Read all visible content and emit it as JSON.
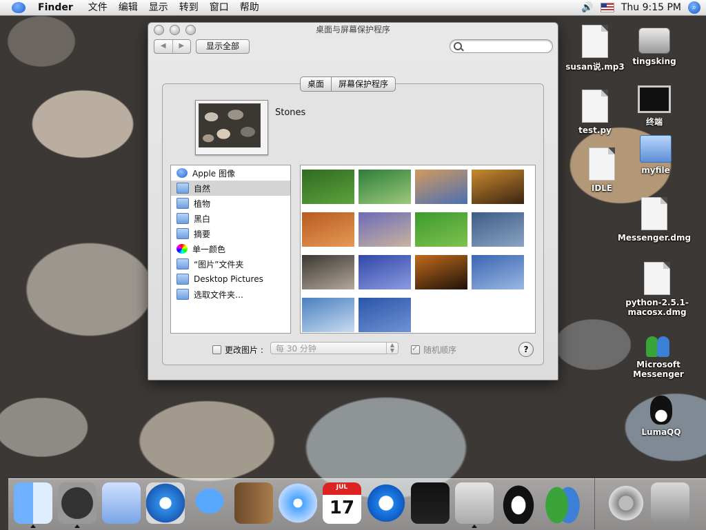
{
  "menubar": {
    "app_name": "Finder",
    "menus": [
      "文件",
      "编辑",
      "显示",
      "转到",
      "窗口",
      "帮助"
    ],
    "clock": "Thu 9:15 PM"
  },
  "window": {
    "title": "桌面与屏幕保护程序",
    "show_all": "显示全部",
    "search_placeholder": "",
    "tabs": [
      "桌面",
      "屏幕保护程序"
    ],
    "current_picture_name": "Stones",
    "sources": [
      {
        "label": "Apple 图像",
        "icon": "apple-icon",
        "selected": false
      },
      {
        "label": "自然",
        "icon": "folder-icon",
        "selected": true
      },
      {
        "label": "植物",
        "icon": "folder-icon",
        "selected": false
      },
      {
        "label": "黑白",
        "icon": "folder-icon",
        "selected": false
      },
      {
        "label": "摘要",
        "icon": "folder-icon",
        "selected": false
      },
      {
        "label": "单一颜色",
        "icon": "color-wheel-icon",
        "selected": false
      },
      {
        "label": "“图片”文件夹",
        "icon": "folder-icon",
        "selected": false
      },
      {
        "label": "Desktop Pictures",
        "icon": "folder-icon",
        "selected": false
      },
      {
        "label": "选取文件夹…",
        "icon": "folder-icon",
        "selected": false
      }
    ],
    "thumbnails": [
      {
        "name": "ladybugs-leaves",
        "colors": [
          "#2f6b22",
          "#5da23c"
        ]
      },
      {
        "name": "green-dewdrop",
        "colors": [
          "#2e7d3a",
          "#9cc97a"
        ]
      },
      {
        "name": "sunset-water",
        "colors": [
          "#d39a5e",
          "#4a6fb3"
        ]
      },
      {
        "name": "leopard-fur",
        "colors": [
          "#c98a2e",
          "#3a2412"
        ]
      },
      {
        "name": "sand-dunes",
        "colors": [
          "#b85a22",
          "#e59a55"
        ]
      },
      {
        "name": "purple-ripples",
        "colors": [
          "#6c6bb8",
          "#c9b3a0"
        ]
      },
      {
        "name": "ladybug-green",
        "colors": [
          "#3c9a2e",
          "#7fc24f"
        ]
      },
      {
        "name": "blue-waves",
        "colors": [
          "#3e5c86",
          "#8aa3c2"
        ]
      },
      {
        "name": "stones",
        "colors": [
          "#3b3733",
          "#b3a89a"
        ]
      },
      {
        "name": "blue-flow",
        "colors": [
          "#3047a8",
          "#8c9ae0"
        ]
      },
      {
        "name": "tiger-stripes",
        "colors": [
          "#c26a1c",
          "#1e120a"
        ]
      },
      {
        "name": "blue-reflection",
        "colors": [
          "#3a65b0",
          "#9ab7e4"
        ]
      },
      {
        "name": "ocean-blue",
        "colors": [
          "#4b7fbf",
          "#c7dcf2"
        ]
      },
      {
        "name": "rippled-sand-blue",
        "colors": [
          "#2a55a8",
          "#6f93d4"
        ]
      }
    ],
    "change_picture_label": "更改图片 :",
    "interval_value": "每 30 分钟",
    "random_order_label": "随机顺序",
    "help_label": "?"
  },
  "desktop_icons": [
    {
      "label": "susan说.mp3",
      "icon": "mp3-file-icon"
    },
    {
      "label": "tingsking",
      "icon": "hard-disk-icon"
    },
    {
      "label": "test.py",
      "icon": "python-file-icon"
    },
    {
      "label": "终端",
      "icon": "terminal-alias-icon"
    },
    {
      "label": "IDLE",
      "icon": "idle-app-icon"
    },
    {
      "label": "myfile",
      "icon": "folder-icon"
    },
    {
      "label": "Messenger.dmg",
      "icon": "disk-image-icon"
    },
    {
      "label": "python-2.5.1-macosx.dmg",
      "icon": "disk-image-icon"
    },
    {
      "label": "Microsoft Messenger",
      "icon": "msn-messenger-icon"
    },
    {
      "label": "LumaQQ",
      "icon": "penguin-icon"
    }
  ],
  "dock": [
    {
      "name": "finder",
      "icon": "finder-icon",
      "running": true
    },
    {
      "name": "dashboard",
      "icon": "dashboard-icon",
      "running": true
    },
    {
      "name": "mail",
      "icon": "mail-stamp-icon",
      "running": false
    },
    {
      "name": "safari",
      "icon": "safari-compass-icon",
      "running": false
    },
    {
      "name": "ichat",
      "icon": "ichat-icon",
      "running": false
    },
    {
      "name": "address-book",
      "icon": "address-book-icon",
      "running": false
    },
    {
      "name": "itunes",
      "icon": "itunes-icon",
      "running": false
    },
    {
      "name": "ical",
      "icon": "ical-icon",
      "running": false
    },
    {
      "name": "quicktime",
      "icon": "quicktime-icon",
      "running": false
    },
    {
      "name": "terminal",
      "icon": "terminal-icon",
      "running": false
    },
    {
      "name": "system-preferences",
      "icon": "system-preferences-icon",
      "running": true
    },
    {
      "name": "lumaqq",
      "icon": "penguin-icon",
      "running": false
    },
    {
      "name": "messenger",
      "icon": "msn-messenger-icon",
      "running": false
    },
    {
      "name": "mail-spring",
      "icon": "at-sign-icon",
      "running": false
    },
    {
      "name": "trash",
      "icon": "trash-icon",
      "running": false
    }
  ],
  "dock_calendar_month": "JUL",
  "dock_calendar_day": "17"
}
